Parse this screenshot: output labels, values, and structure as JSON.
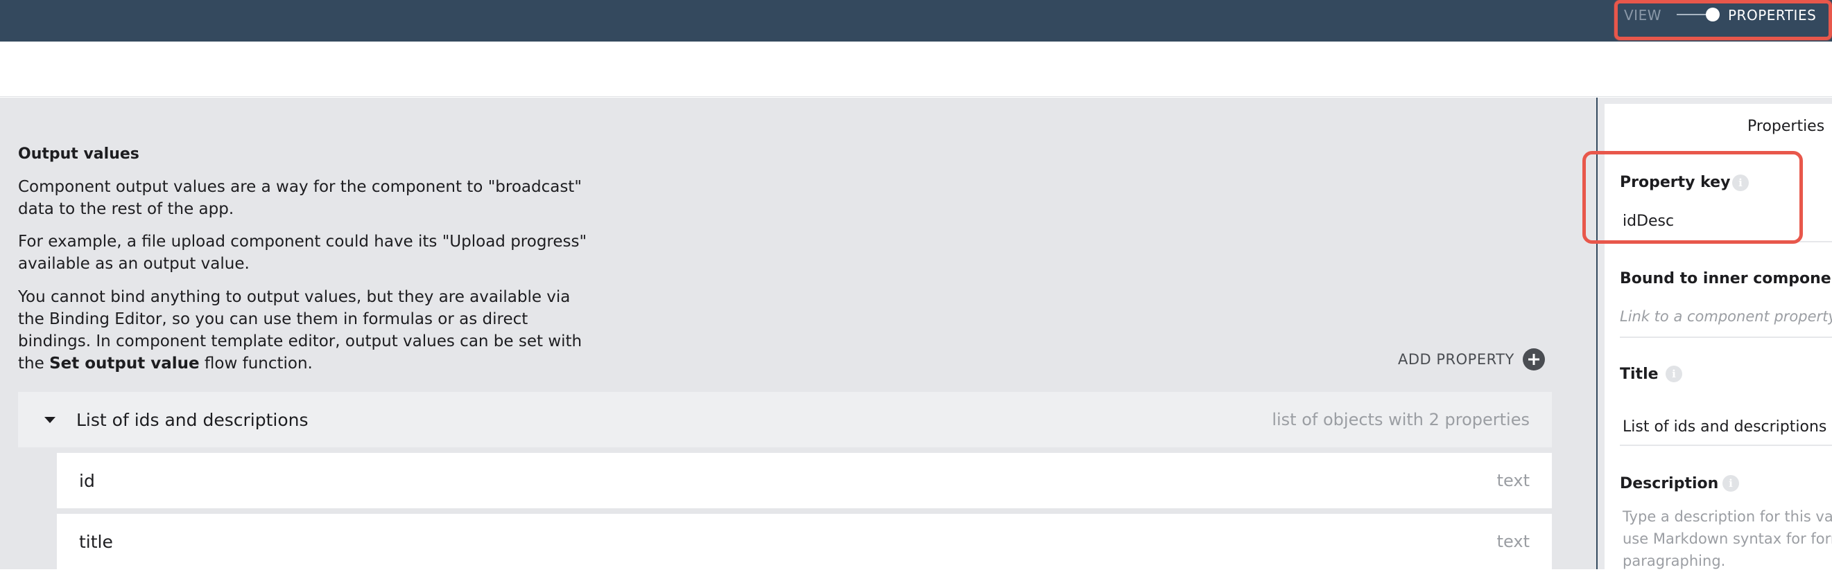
{
  "topbar": {
    "mode_view": "VIEW",
    "mode_properties": "PROPERTIES",
    "toggle_state": "properties"
  },
  "output_values": {
    "title": "Output values",
    "para1": "Component output values are a way for the component to \"broadcast\" data to the rest of the app.",
    "para2": "For example, a file upload component could have its \"Upload progress\" available as an output value.",
    "para3_before": "You cannot bind anything to output values, but they are available via the Binding Editor, so you can use them in formulas or as direct bindings. In component template editor, output values can be set with the ",
    "para3_bold": "Set output value",
    "para3_after": " flow function."
  },
  "add_property": {
    "label": "ADD PROPERTY",
    "icon": "plus-circle-icon"
  },
  "property_list": {
    "group": {
      "name": "List of ids and descriptions",
      "type": "list of objects with 2 properties",
      "expanded": true
    },
    "children": [
      {
        "name": "id",
        "type": "text"
      },
      {
        "name": "title",
        "type": "text"
      }
    ]
  },
  "panel": {
    "header": "Properties",
    "property_key": {
      "label": "Property key",
      "value": "idDesc"
    },
    "bound_inner": {
      "label": "Bound to inner component",
      "placeholder": "Link to a component property"
    },
    "title_field": {
      "label": "Title",
      "value": "List of ids and descriptions"
    },
    "description": {
      "label": "Description",
      "placeholder_line1": "Type a description for this va",
      "placeholder_line2": "use Markdown syntax for form",
      "placeholder_line3": "paragraphing."
    }
  },
  "colors": {
    "topbar": "#34495e",
    "highlight": "#e8574b",
    "main_bg": "#e5e6e9"
  }
}
